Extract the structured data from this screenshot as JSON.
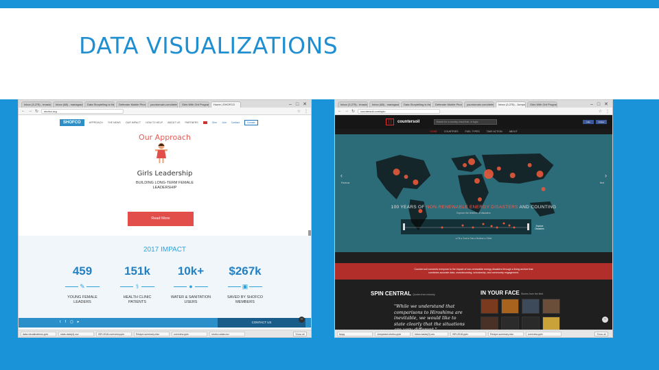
{
  "slide": {
    "title": "DATA VISUALIZATIONS"
  },
  "left_browser": {
    "tabs": [
      "Inbox (3,275) - tmaslow",
      "Inbox (88) - mariagrazi",
      "Data Storytelling is the",
      "Defender Mobile Phones",
      "yourdomain.com/defende",
      "Girls With Grit Program",
      "Home | SHOFCO"
    ],
    "url": "shofco.org",
    "nav": {
      "logo": "SHOFCO",
      "menu": [
        "APPROACH",
        "THE NEWS",
        "OUR IMPACT",
        "HOW TO HELP",
        "ABOUT US",
        "PARTNERS"
      ],
      "menu_right": [
        "Give",
        "Join",
        "Contact"
      ],
      "donate": "Donate"
    },
    "approach_title": "Our Approach",
    "program_title": "Girls Leadership",
    "program_sub_line1": "BUILDING LONG-TERM FEMALE",
    "program_sub_line2": "LEADERSHIP",
    "read_more": "Read More",
    "impact_title": "2017 IMPACT",
    "stats": [
      {
        "value": "459",
        "label1": "YOUNG FEMALE",
        "label2": "LEADERS",
        "icon": "pencil-icon"
      },
      {
        "value": "151k",
        "label1": "HEALTH CLINIC",
        "label2": "PATIENTS",
        "icon": "stethoscope-icon"
      },
      {
        "value": "10k+",
        "label1": "WATER & SANITATION",
        "label2": "USERS",
        "icon": "water-drop-icon"
      },
      {
        "value": "$267k",
        "label1": "SAVED BY SHOFCO",
        "label2": "MEMBERS",
        "icon": "money-icon"
      }
    ],
    "contact_us": "CONTACT US",
    "taskbar": [
      "data-visualizations.pptx",
      "stats-data(4).csv",
      "ISR-2018-overview.pptx",
      "Recipe-summary.xlsx",
      "overview.pptx",
      "shofco-stats.csv"
    ],
    "show_all": "Show all"
  },
  "right_browser": {
    "tabs": [
      "Inbox (3,275) - tmaslow",
      "Inbox (88) - mariagrazi",
      "Data Storytelling is the",
      "Defender Mobile Phones",
      "yourdomain.com/defende",
      "Inbox (3,275) - Jumpstart",
      "Girls With Grit Program"
    ],
    "url": "countersoil.com/spin",
    "logo": "countersoil",
    "search_placeholder": "Search for a country, fossil fuel, or topic",
    "social": [
      "Like",
      "Follow"
    ],
    "menu": [
      "HOME",
      "COUNTRIES",
      "FUEL TYPES",
      "TAKE ACTION",
      "ABOUT"
    ],
    "side_left": "Previous",
    "side_right": "Next",
    "headline_pre": "100 YEARS OF ",
    "headline_hl": "NON-RENEWABLE ENERGY DISASTERS",
    "headline_post": " AND COUNTING",
    "headline_sub": "Explore the timeline of disasters",
    "explore": "Explore Disasters",
    "legend": "● Oil  ● Coal  ● Gas  ● Nuclear  ● Other",
    "banner_line1": "Counter:soil connects everyone to the impact of non-renewable energy disasters through a living archive that",
    "banner_line2": "combines accurate data, crowdsourcing, scholarship, and community engagement.",
    "spin_title": "SPIN CENTRAL",
    "spin_sub": "Quotes from industry",
    "quote": "\"While we understand that comparisons to Hiroshima are inevitable, we would like to state clearly that the situations are very different.\"",
    "face_title": "IN YOUR FACE",
    "face_sub": "Stories from the field",
    "taskbar": [
      "bpqq",
      "Jumpstart-shofco.pptx",
      "Inbox-tasks(3).csv",
      "ISR-2018.pptx",
      "Recipe-summary.xlsx",
      "overview.pptx"
    ],
    "show_all": "Show all"
  }
}
